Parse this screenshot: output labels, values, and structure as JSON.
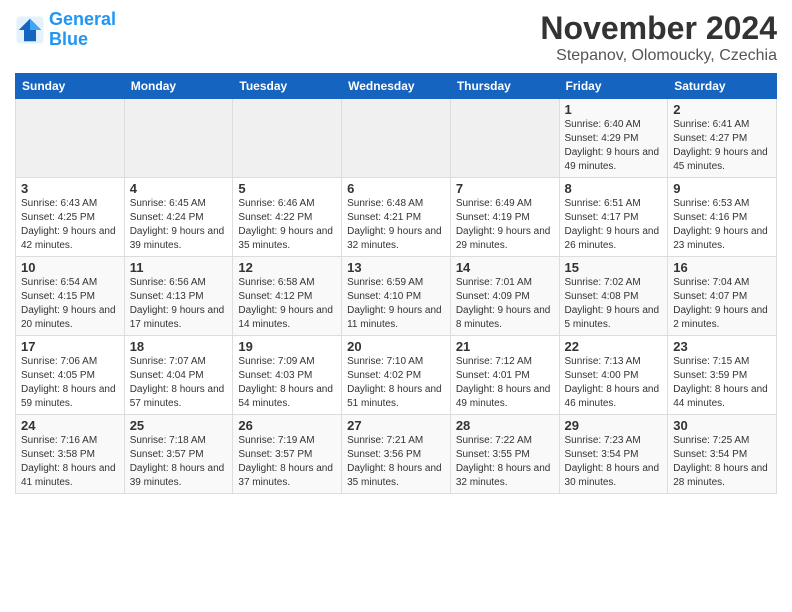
{
  "header": {
    "logo_line1": "General",
    "logo_line2": "Blue",
    "month": "November 2024",
    "location": "Stepanov, Olomoucky, Czechia"
  },
  "days_of_week": [
    "Sunday",
    "Monday",
    "Tuesday",
    "Wednesday",
    "Thursday",
    "Friday",
    "Saturday"
  ],
  "weeks": [
    [
      {
        "day": "",
        "info": ""
      },
      {
        "day": "",
        "info": ""
      },
      {
        "day": "",
        "info": ""
      },
      {
        "day": "",
        "info": ""
      },
      {
        "day": "",
        "info": ""
      },
      {
        "day": "1",
        "info": "Sunrise: 6:40 AM\nSunset: 4:29 PM\nDaylight: 9 hours and 49 minutes."
      },
      {
        "day": "2",
        "info": "Sunrise: 6:41 AM\nSunset: 4:27 PM\nDaylight: 9 hours and 45 minutes."
      }
    ],
    [
      {
        "day": "3",
        "info": "Sunrise: 6:43 AM\nSunset: 4:25 PM\nDaylight: 9 hours and 42 minutes."
      },
      {
        "day": "4",
        "info": "Sunrise: 6:45 AM\nSunset: 4:24 PM\nDaylight: 9 hours and 39 minutes."
      },
      {
        "day": "5",
        "info": "Sunrise: 6:46 AM\nSunset: 4:22 PM\nDaylight: 9 hours and 35 minutes."
      },
      {
        "day": "6",
        "info": "Sunrise: 6:48 AM\nSunset: 4:21 PM\nDaylight: 9 hours and 32 minutes."
      },
      {
        "day": "7",
        "info": "Sunrise: 6:49 AM\nSunset: 4:19 PM\nDaylight: 9 hours and 29 minutes."
      },
      {
        "day": "8",
        "info": "Sunrise: 6:51 AM\nSunset: 4:17 PM\nDaylight: 9 hours and 26 minutes."
      },
      {
        "day": "9",
        "info": "Sunrise: 6:53 AM\nSunset: 4:16 PM\nDaylight: 9 hours and 23 minutes."
      }
    ],
    [
      {
        "day": "10",
        "info": "Sunrise: 6:54 AM\nSunset: 4:15 PM\nDaylight: 9 hours and 20 minutes."
      },
      {
        "day": "11",
        "info": "Sunrise: 6:56 AM\nSunset: 4:13 PM\nDaylight: 9 hours and 17 minutes."
      },
      {
        "day": "12",
        "info": "Sunrise: 6:58 AM\nSunset: 4:12 PM\nDaylight: 9 hours and 14 minutes."
      },
      {
        "day": "13",
        "info": "Sunrise: 6:59 AM\nSunset: 4:10 PM\nDaylight: 9 hours and 11 minutes."
      },
      {
        "day": "14",
        "info": "Sunrise: 7:01 AM\nSunset: 4:09 PM\nDaylight: 9 hours and 8 minutes."
      },
      {
        "day": "15",
        "info": "Sunrise: 7:02 AM\nSunset: 4:08 PM\nDaylight: 9 hours and 5 minutes."
      },
      {
        "day": "16",
        "info": "Sunrise: 7:04 AM\nSunset: 4:07 PM\nDaylight: 9 hours and 2 minutes."
      }
    ],
    [
      {
        "day": "17",
        "info": "Sunrise: 7:06 AM\nSunset: 4:05 PM\nDaylight: 8 hours and 59 minutes."
      },
      {
        "day": "18",
        "info": "Sunrise: 7:07 AM\nSunset: 4:04 PM\nDaylight: 8 hours and 57 minutes."
      },
      {
        "day": "19",
        "info": "Sunrise: 7:09 AM\nSunset: 4:03 PM\nDaylight: 8 hours and 54 minutes."
      },
      {
        "day": "20",
        "info": "Sunrise: 7:10 AM\nSunset: 4:02 PM\nDaylight: 8 hours and 51 minutes."
      },
      {
        "day": "21",
        "info": "Sunrise: 7:12 AM\nSunset: 4:01 PM\nDaylight: 8 hours and 49 minutes."
      },
      {
        "day": "22",
        "info": "Sunrise: 7:13 AM\nSunset: 4:00 PM\nDaylight: 8 hours and 46 minutes."
      },
      {
        "day": "23",
        "info": "Sunrise: 7:15 AM\nSunset: 3:59 PM\nDaylight: 8 hours and 44 minutes."
      }
    ],
    [
      {
        "day": "24",
        "info": "Sunrise: 7:16 AM\nSunset: 3:58 PM\nDaylight: 8 hours and 41 minutes."
      },
      {
        "day": "25",
        "info": "Sunrise: 7:18 AM\nSunset: 3:57 PM\nDaylight: 8 hours and 39 minutes."
      },
      {
        "day": "26",
        "info": "Sunrise: 7:19 AM\nSunset: 3:57 PM\nDaylight: 8 hours and 37 minutes."
      },
      {
        "day": "27",
        "info": "Sunrise: 7:21 AM\nSunset: 3:56 PM\nDaylight: 8 hours and 35 minutes."
      },
      {
        "day": "28",
        "info": "Sunrise: 7:22 AM\nSunset: 3:55 PM\nDaylight: 8 hours and 32 minutes."
      },
      {
        "day": "29",
        "info": "Sunrise: 7:23 AM\nSunset: 3:54 PM\nDaylight: 8 hours and 30 minutes."
      },
      {
        "day": "30",
        "info": "Sunrise: 7:25 AM\nSunset: 3:54 PM\nDaylight: 8 hours and 28 minutes."
      }
    ]
  ]
}
